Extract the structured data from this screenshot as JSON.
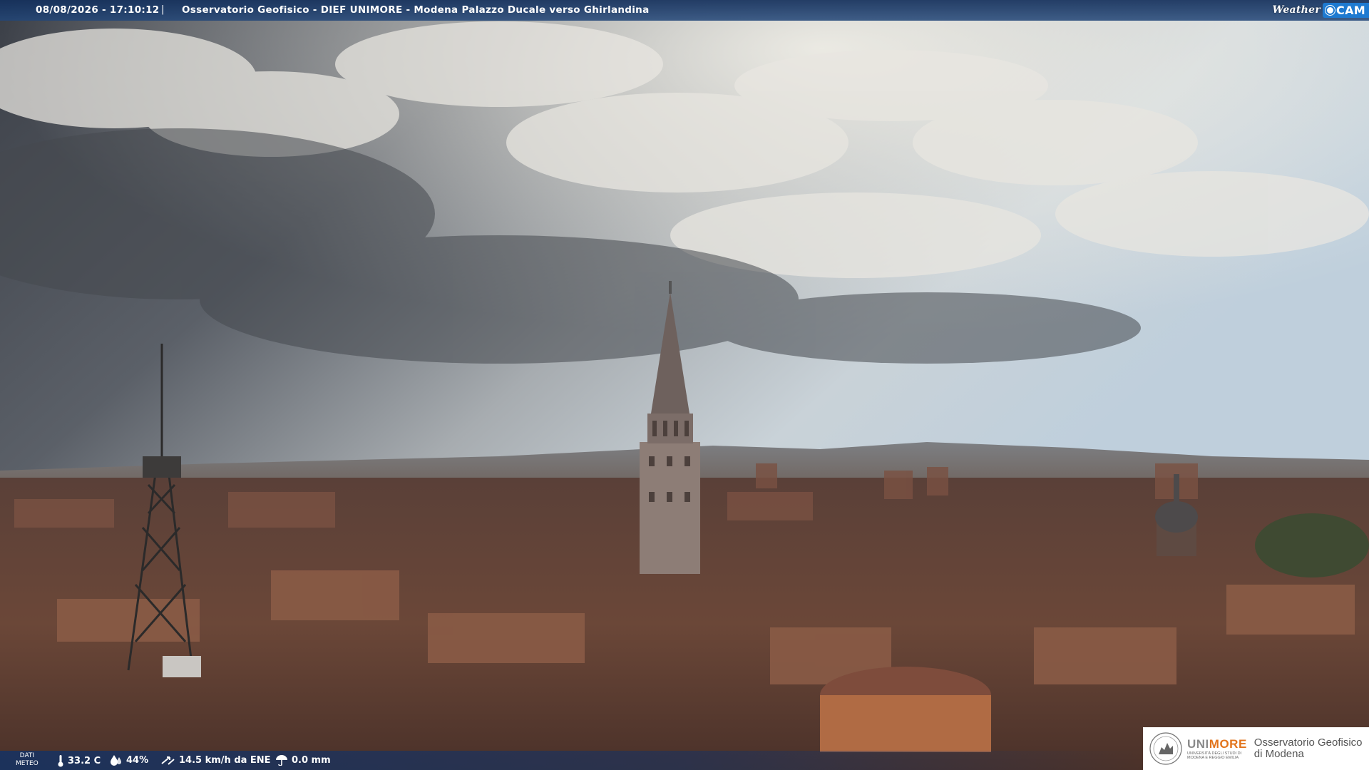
{
  "header": {
    "timestamp": "08/08/2026 - 17:10:12",
    "separator": "|",
    "location": "Osservatorio Geofisico - DIEF UNIMORE - Modena Palazzo Ducale verso Ghirlandina",
    "logo_weather": "Weather",
    "logo_cam": "CAM"
  },
  "weather": {
    "label_line1": "DATI",
    "label_line2": "METEO",
    "temperature": "33.2 C",
    "humidity": "44%",
    "wind": "14.5 km/h da ENE",
    "rain": "0.0 mm"
  },
  "branding": {
    "uni_prefix": "UNI",
    "uni_suffix": "MORE",
    "uni_sub1": "UNIVERSITÀ DEGLI STUDI DI",
    "uni_sub2": "MODENA E REGGIO EMILIA",
    "observatory_line1": "Osservatorio Geofisico",
    "observatory_line2": "di Modena"
  },
  "colors": {
    "bar": "#1d3e72",
    "unimore_orange": "#e2741c",
    "weathercam_blue": "#1e7ad1"
  }
}
